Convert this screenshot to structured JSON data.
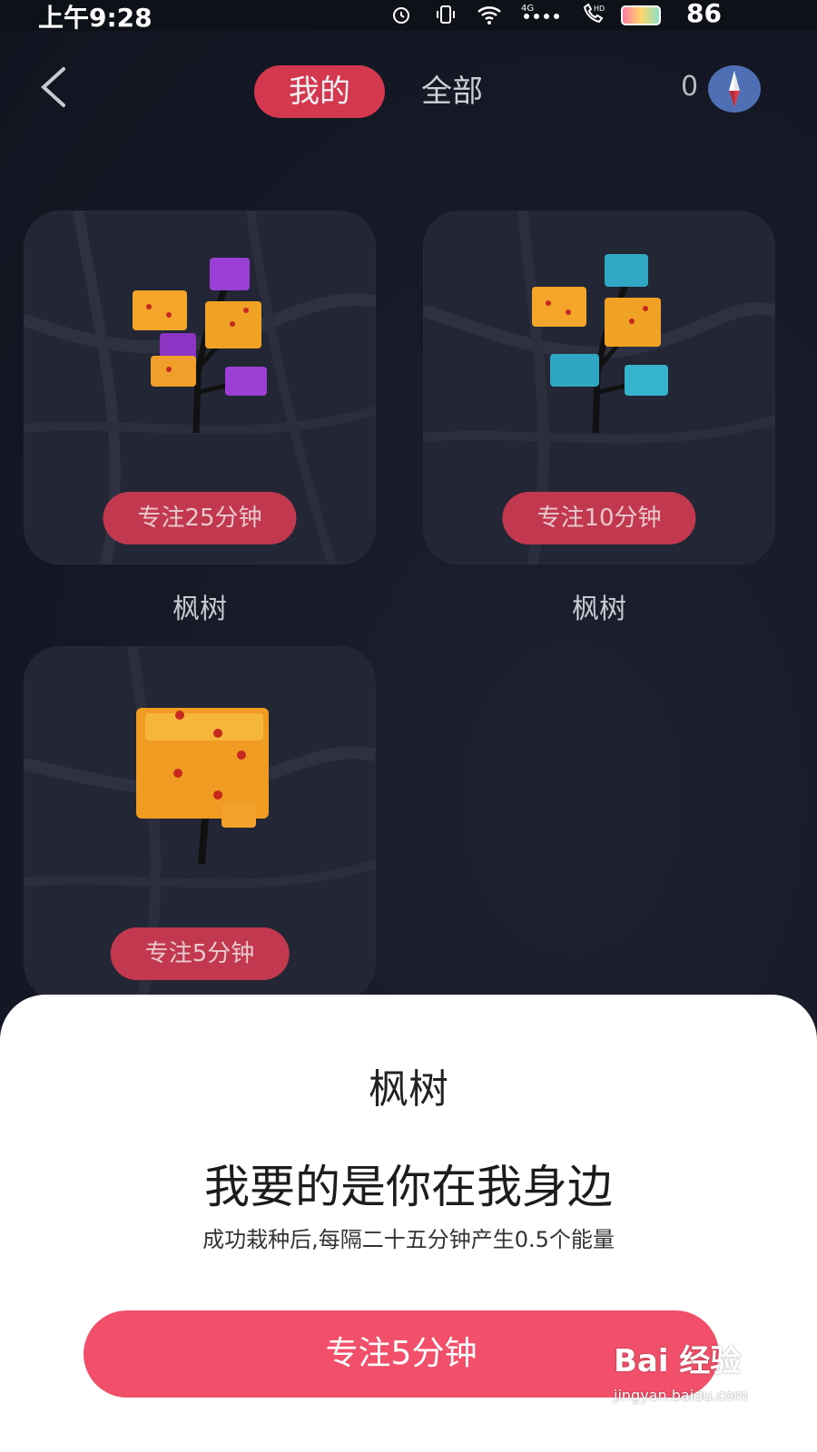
{
  "status_bar": {
    "time": "上午9:28",
    "battery_level": "86",
    "icons": [
      "alarm-icon",
      "vibrate-icon",
      "wifi-icon",
      "signal-4g-icon",
      "hd-call-icon",
      "battery-icon"
    ]
  },
  "header": {
    "tabs": [
      {
        "label": "我的",
        "active": true
      },
      {
        "label": "全部",
        "active": false
      }
    ],
    "coin_count": "0"
  },
  "trees": [
    {
      "name": "枫树",
      "focus_label": "专注25分钟",
      "variant": "orange-purple"
    },
    {
      "name": "枫树",
      "focus_label": "专注10分钟",
      "variant": "orange-cyan"
    },
    {
      "name": "",
      "focus_label": "专注5分钟",
      "variant": "orange-block"
    }
  ],
  "sheet": {
    "title": "枫树",
    "quote": "我要的是你在我身边",
    "description": "成功栽种后,每隔二十五分钟产生0.5个能量",
    "button_label": "专注5分钟"
  },
  "watermark": {
    "brand": "Bai 经验",
    "url": "jingyan.baidu.com"
  },
  "colors": {
    "background": "#181b27",
    "accent": "#d4384f",
    "cta": "#f2506a"
  }
}
